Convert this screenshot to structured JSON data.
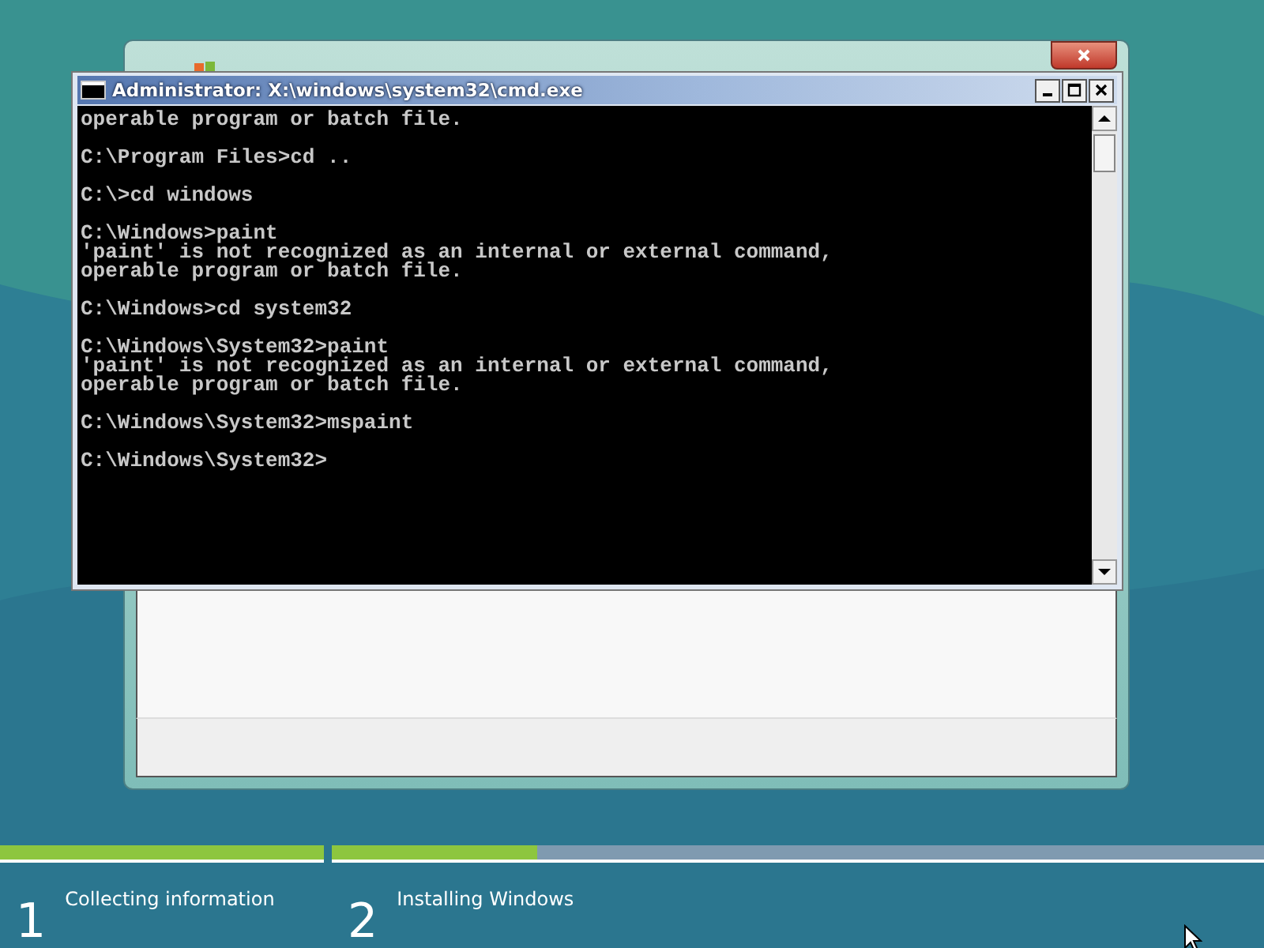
{
  "console_window": {
    "title": "Administrator: X:\\windows\\system32\\cmd.exe",
    "blocks": [
      [
        "operable program or batch file."
      ],
      [
        "C:\\Program Files>cd .."
      ],
      [
        "C:\\>cd windows"
      ],
      [
        "C:\\Windows>paint",
        "'paint' is not recognized as an internal or external command,",
        "operable program or batch file."
      ],
      [
        "C:\\Windows>cd system32"
      ],
      [
        "C:\\Windows\\System32>paint",
        "'paint' is not recognized as an internal or external command,",
        "operable program or batch file."
      ],
      [
        "C:\\Windows\\System32>mspaint"
      ],
      [
        "C:\\Windows\\System32>"
      ]
    ]
  },
  "setup_steps": [
    {
      "number": "1",
      "label": "Collecting information",
      "level": 1
    },
    {
      "number": "2",
      "label": "Installing Windows",
      "level": 0.22
    }
  ]
}
